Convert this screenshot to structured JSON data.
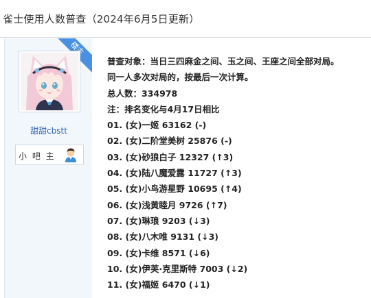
{
  "page": {
    "title": "雀士使用人数普查（2024年6月5日更新）"
  },
  "sidebar": {
    "badge": "楼主",
    "username": "甜甜cbstt",
    "role": "小 吧 主",
    "avatar_icon": "anime-catgirl-avatar",
    "role_icon": "user-avatar-icon"
  },
  "post": {
    "lines": [
      "普查对象：当日三四麻金之间、玉之间、王座之间全部对局。",
      "同一人多次对局的，按最后一次计算。",
      "总人数：334978",
      "注：排名变化与4月17日相比",
      "01. (女)一姬 63162 (-)",
      "02. (女)二阶堂美树 25876 (-)",
      "03. (女)砂狼白子 12327 (↑3)",
      "04. (女)陆八魔爱露 11727 (↑3)",
      "05. (女)小鸟游星野 10695 (↑4)",
      "06. (女)浅黄睦月 9726 (↑7)",
      "07. (女)琳琅 9203 (↓3)",
      "08. (女)八木唯 9131 (↓3)",
      "09. (女)卡维 8571 (↓6)",
      "10. (女)伊芙·克里斯特 7003 (↓2)",
      "11. (女)福姬 6470 (↓1)"
    ]
  },
  "colors": {
    "badge": "#4a90e2",
    "username": "#2d64b3",
    "sidebar_bg": "#f2f7fc"
  }
}
